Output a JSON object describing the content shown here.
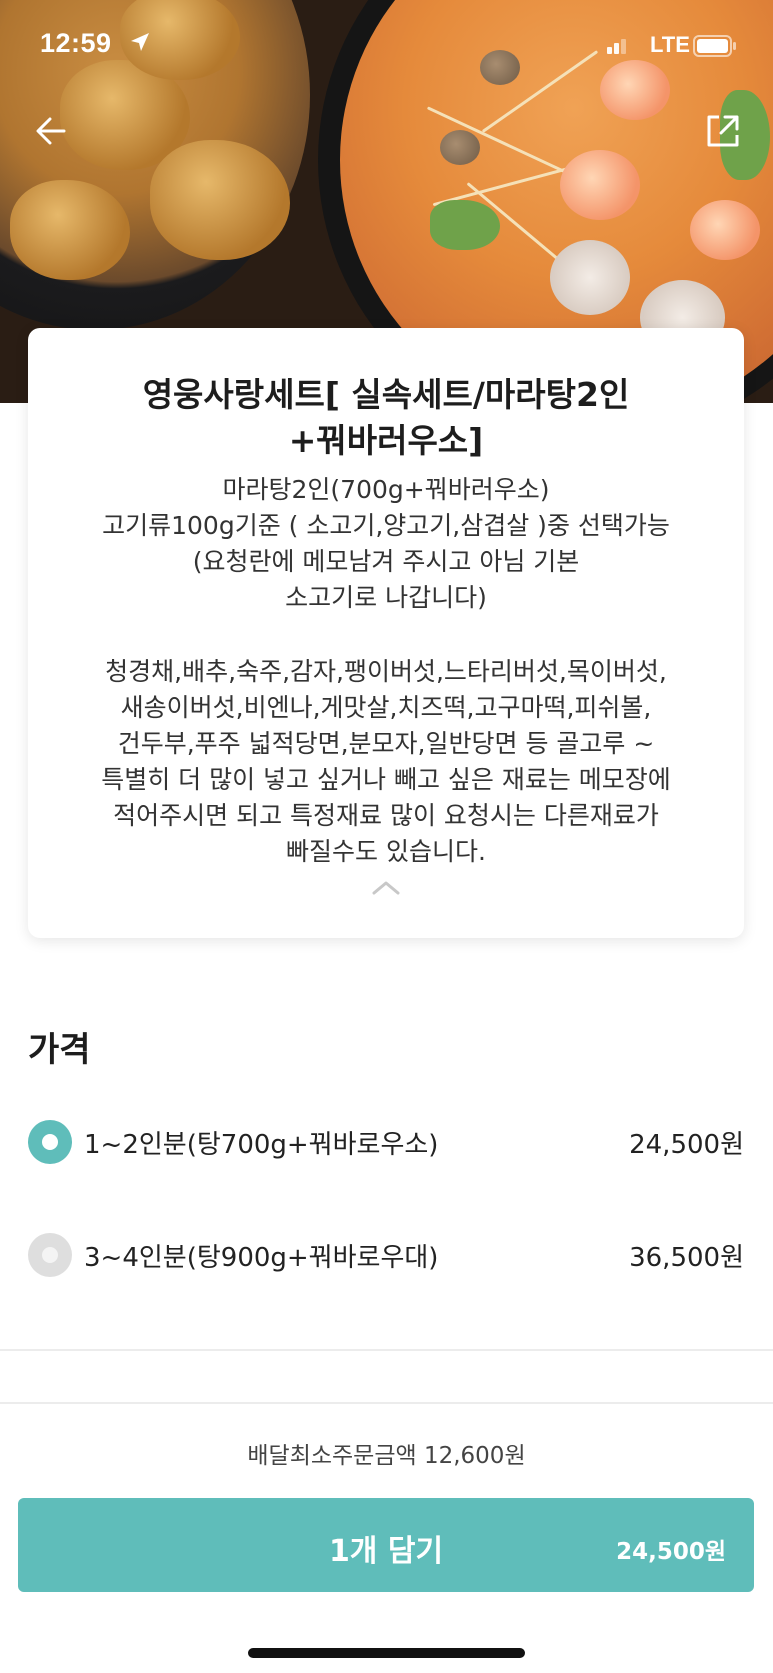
{
  "status_bar": {
    "time": "12:59",
    "network": "LTE"
  },
  "hero": {
    "image_alt": "hero-food-photo"
  },
  "nav": {
    "back_icon": "arrow-left-icon",
    "share_icon": "share-external-icon"
  },
  "menu": {
    "title": "영웅사랑세트[ 실속세트/마라탕2인\n+꿔바러우소]",
    "description": "마라탕2인(700g+꿔바러우소)\n고기류100g기준 ( 소고기,양고기,삼겹살 )중 선택가능\n(요청란에 메모남겨 주시고 아님 기본\n소고기로 나갑니다)",
    "detail": "청경채,배추,숙주,감자,팽이버섯,느타리버섯,목이버섯,\n새송이버섯,비엔나,게맛살,치즈떡,고구마떡,피쉬볼,\n건두부,푸주 넓적당면,분모자,일반당면 등 골고루 ~\n특별히 더 많이 넣고 싶거나 빼고 싶은 재료는 메모장에\n적어주시면 되고 특정재료 많이 요청시는 다른재료가\n빠질수도 있습니다.",
    "collapse_icon": "chevron-up-icon"
  },
  "price": {
    "heading": "가격",
    "options": [
      {
        "label": "1~2인분(탕700g+꿔바로우소)",
        "price": "24,500원",
        "selected": true
      },
      {
        "label": "3~4인분(탕900g+꿔바로우대)",
        "price": "36,500원",
        "selected": false
      }
    ]
  },
  "order": {
    "min_order": "배달최소주문금액 12,600원",
    "add_button_label": "1개 담기",
    "add_button_price": "24,500원"
  },
  "colors": {
    "accent": "#5fbdba",
    "radio_unselected": "#dedede",
    "text": "#222222"
  }
}
